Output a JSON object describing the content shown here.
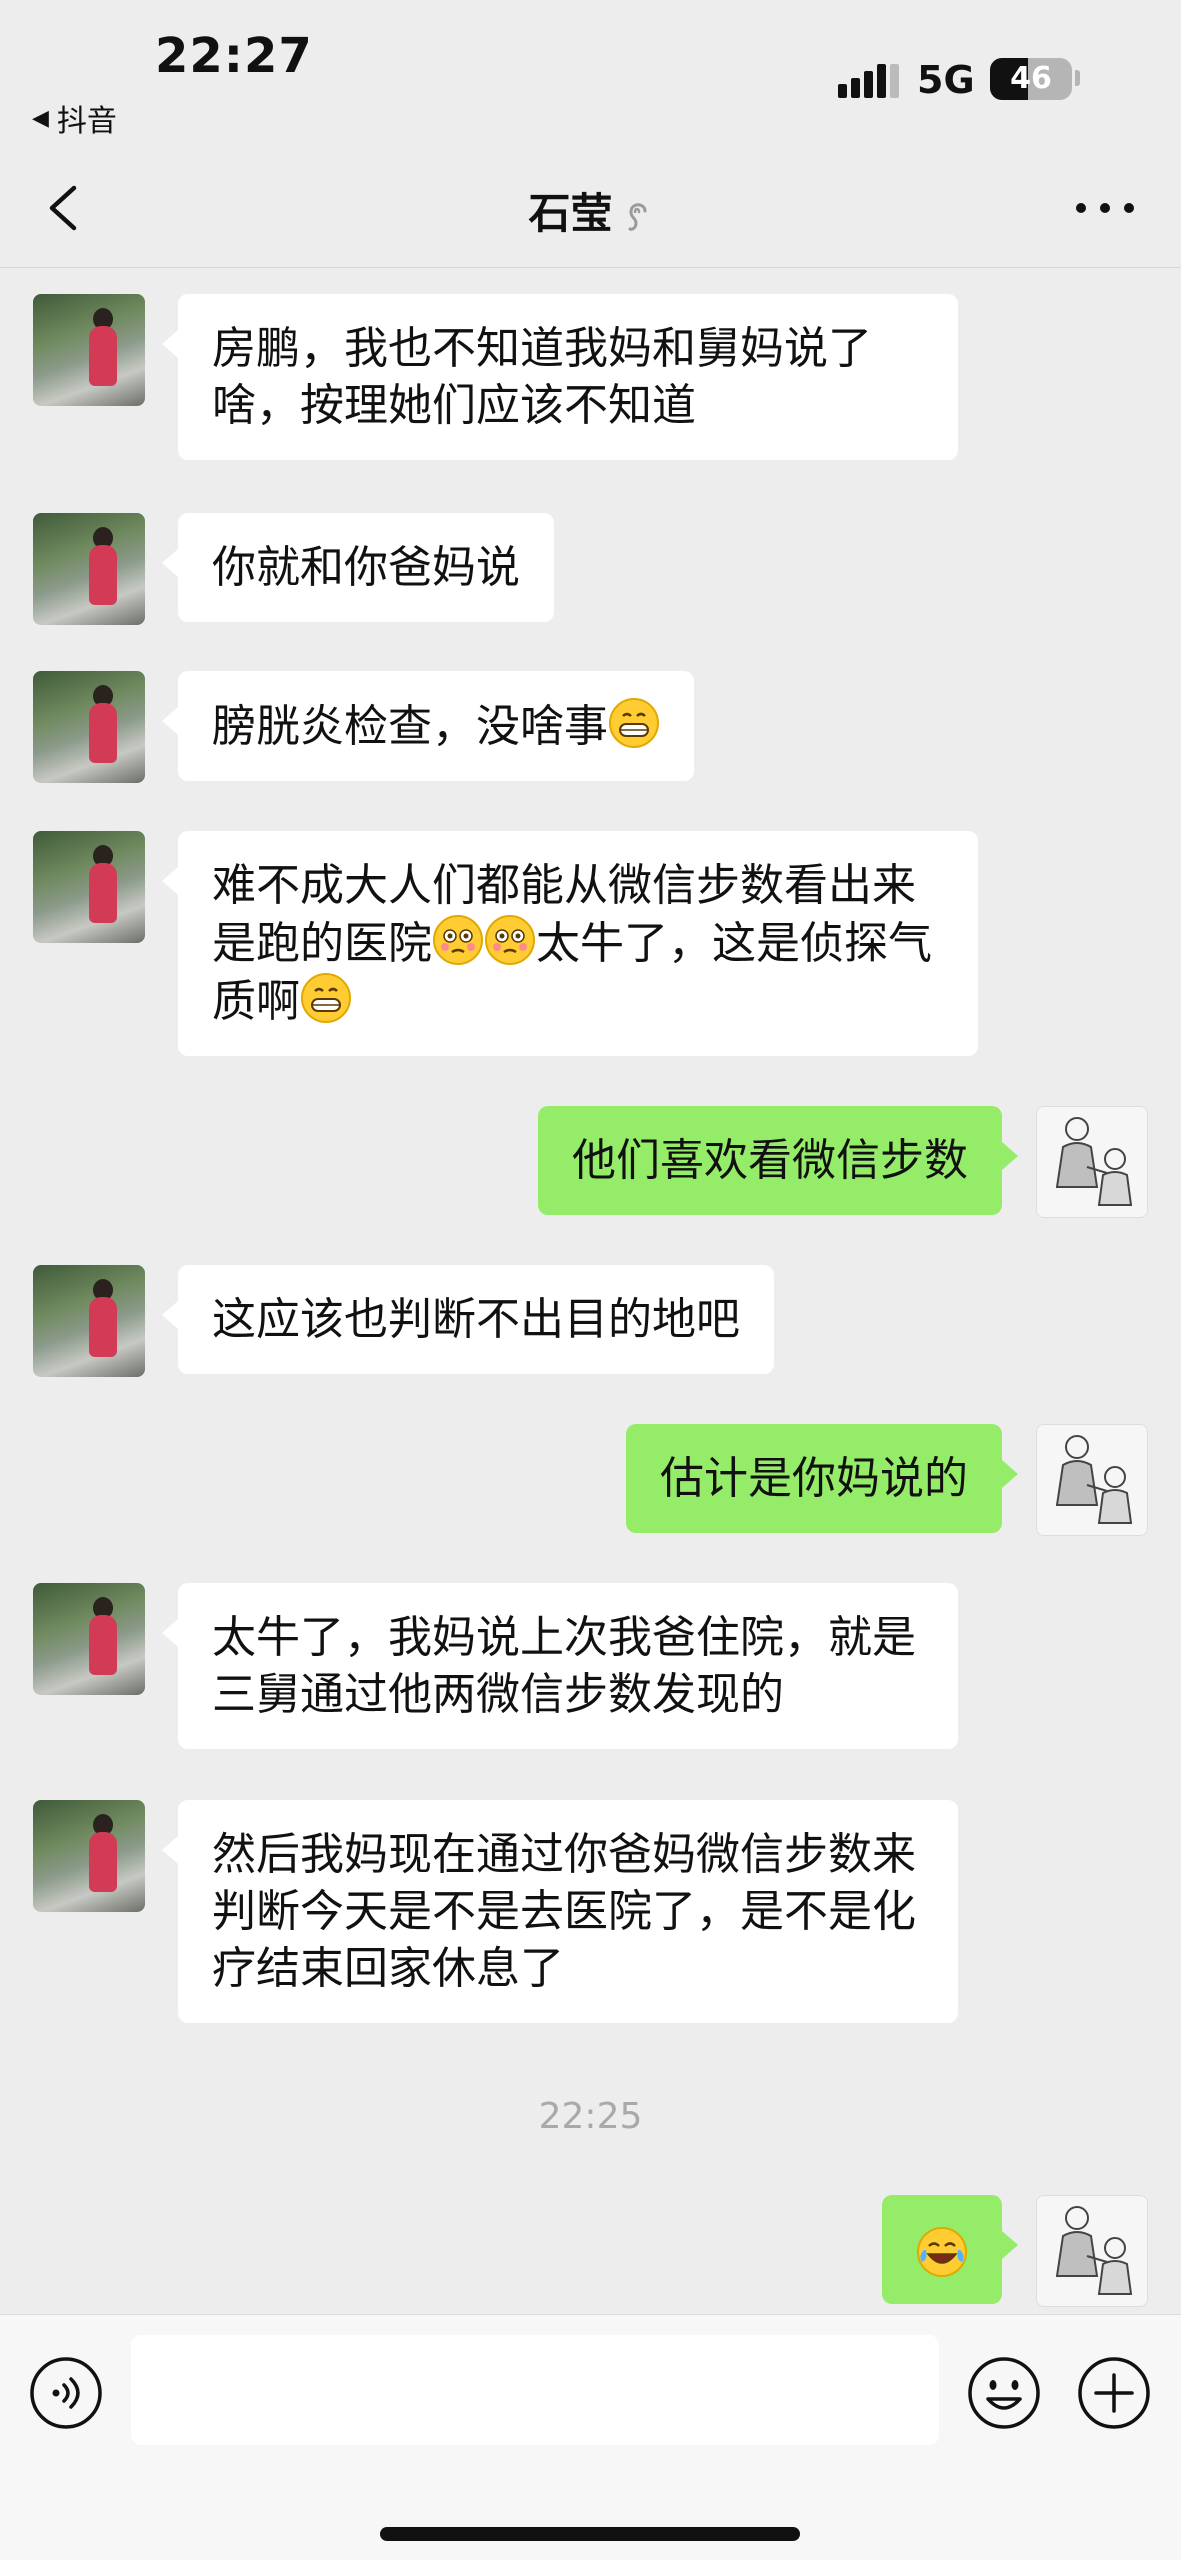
{
  "status_bar": {
    "time": "22:27",
    "back_app": "抖音",
    "network": "5G",
    "battery": "46",
    "battery_level": 0.46
  },
  "nav": {
    "title": "石莹"
  },
  "icons": {
    "back": "chevron-left-icon",
    "listen_mode": "ear-icon",
    "more": "more-dots-icon",
    "voice": "voice-icon",
    "emoji": "smile-icon",
    "plus": "plus-icon"
  },
  "messages": [
    {
      "side": "in",
      "text": "房鹏，我也不知道我妈和舅妈说了啥，按理她们应该不知道"
    },
    {
      "side": "in",
      "text": "你就和你爸妈说"
    },
    {
      "side": "in",
      "text": "膀胱炎检查，没啥事",
      "emoji_after": "grin"
    },
    {
      "side": "in",
      "text_parts": [
        "难不成大人们都能从微信步数看出来是跑的医院",
        "太牛了，这是侦探气质啊"
      ],
      "emojis": [
        "flushed",
        "flushed",
        "grin"
      ]
    },
    {
      "side": "out",
      "text": "他们喜欢看微信步数"
    },
    {
      "side": "in",
      "text": "这应该也判断不出目的地吧"
    },
    {
      "side": "out",
      "text": "估计是你妈说的"
    },
    {
      "side": "in",
      "text": "太牛了，我妈说上次我爸住院，就是三舅通过他两微信步数发现的"
    },
    {
      "side": "in",
      "text": "然后我妈现在通过你爸妈微信步数来判断今天是不是去医院了，是不是化疗结束回家休息了"
    },
    {
      "side": "out",
      "emoji": "tears-of-joy"
    }
  ],
  "timestamp": "22:25",
  "input": {
    "value": "",
    "placeholder": ""
  },
  "colors": {
    "background": "#ededed",
    "bubble_in": "#ffffff",
    "bubble_out": "#95ec69",
    "timestamp": "#a9a9a9"
  }
}
